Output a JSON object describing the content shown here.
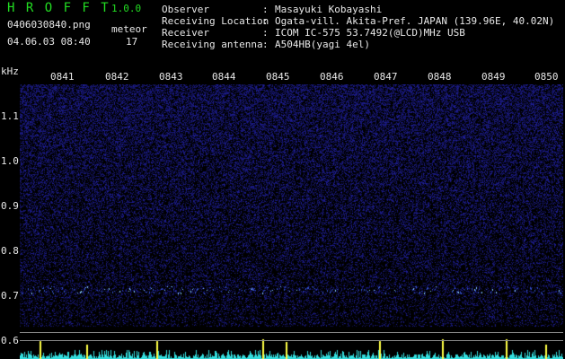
{
  "header": {
    "app_title": "H R O F F T",
    "version": "1.0.0",
    "filename": "0406030840.png",
    "datetime": "04.06.03 08:40",
    "meteor_label": "meteor",
    "meteor_count": "17"
  },
  "info": [
    {
      "key": "Observer",
      "value": "Masayuki Kobayashi"
    },
    {
      "key": "Receiving Location",
      "value": "Ogata-vill. Akita-Pref. JAPAN (139.96E, 40.02N)"
    },
    {
      "key": "Receiver",
      "value": "ICOM IC-575 53.7492(@LCD)MHz USB"
    },
    {
      "key": "Receiving antenna",
      "value": "A504HB(yagi 4el)"
    }
  ],
  "axes": {
    "y_unit": "kHz",
    "y_ticks": [
      "1.1",
      "1.0",
      "0.9",
      "0.8",
      "0.7",
      "0.6"
    ],
    "x_ticks": [
      "0841",
      "0842",
      "0843",
      "0844",
      "0845",
      "0846",
      "0847",
      "0848",
      "0849",
      "0850"
    ]
  },
  "colors": {
    "header_green": "#22dd22",
    "text": "#e8e8e8",
    "noise": "#1a1a8a",
    "echo": "#66aaff",
    "trace_cyan": "#33dddd",
    "trace_yellow": "#ffff44"
  }
}
